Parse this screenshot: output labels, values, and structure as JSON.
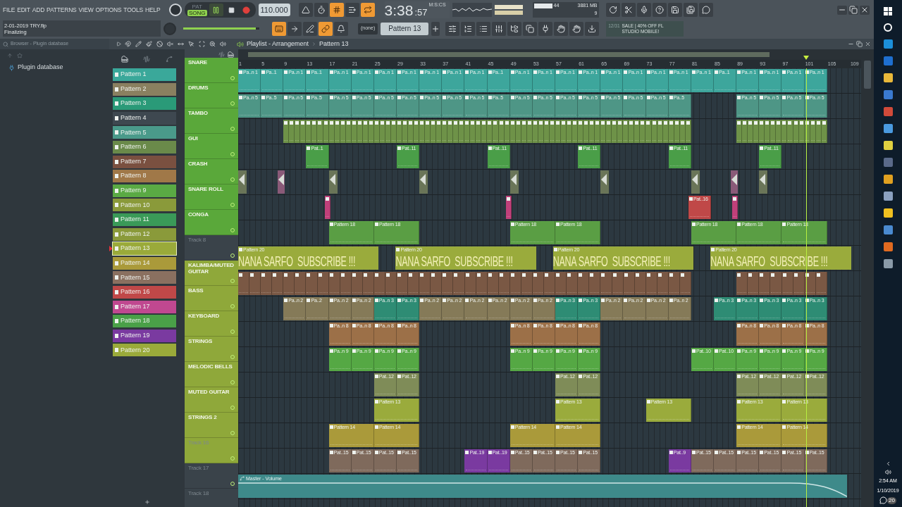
{
  "menu": [
    "FILE",
    "EDIT",
    "ADD",
    "PATTERNS",
    "VIEW",
    "OPTIONS",
    "TOOLS",
    "HELP"
  ],
  "project": {
    "file": "2-01-2019 TRY.flp",
    "status": "Finalizing"
  },
  "modes": [
    {
      "label": "PAT",
      "selected": false
    },
    {
      "label": "SONG",
      "selected": true
    }
  ],
  "tempo": "110.000",
  "time": {
    "main": "3:38",
    "cs": ":57",
    "unit": "M:S:CS"
  },
  "toggles_row1": [
    {
      "kind": "metronome",
      "on": false
    },
    {
      "kind": "wait",
      "on": false
    },
    {
      "kind": "countdown",
      "on": true
    },
    {
      "kind": "step",
      "on": false
    },
    {
      "kind": "loop",
      "on": true
    }
  ],
  "cpu": {
    "cpu": "44",
    "memory": "3881 MB",
    "polyphony": "9"
  },
  "main_volume": {
    "level": 0.95
  },
  "toggles_row2": [
    {
      "kind": "typing",
      "on": true
    },
    {
      "kind": "arrow",
      "on": false
    },
    {
      "kind": "pen",
      "on": false
    },
    {
      "kind": "link",
      "on": true
    },
    {
      "kind": "bell",
      "on": false
    }
  ],
  "pattern_picker": {
    "none": "(none)",
    "current": "Pattern 13"
  },
  "news": {
    "date": "12/31",
    "text": "SALE | 40% OFF FL STUDIO MOBILE!"
  },
  "browser": {
    "title": "Browser - Plugin database",
    "items": [
      {
        "label": "Plugin database"
      }
    ]
  },
  "playlist": {
    "title": "Playlist - Arrangement",
    "pattern": "Pattern 13",
    "patterns": [
      {
        "label": "Pattern 1",
        "color": "#3aa89a",
        "selected": false
      },
      {
        "label": "Pattern 2",
        "color": "#8a8060",
        "selected": false
      },
      {
        "label": "Pattern 3",
        "color": "#2a9a78",
        "selected": false
      },
      {
        "label": "Pattern 4",
        "color": "#3e4850",
        "selected": false
      },
      {
        "label": "Pattern 5",
        "color": "#4a9a8a",
        "selected": false
      },
      {
        "label": "Pattern 6",
        "color": "#6a8a4a",
        "selected": false
      },
      {
        "label": "Pattern 7",
        "color": "#7a5040",
        "selected": false
      },
      {
        "label": "Pattern 8",
        "color": "#a07848",
        "selected": false
      },
      {
        "label": "Pattern 9",
        "color": "#5aaa44",
        "selected": false
      },
      {
        "label": "Pattern 10",
        "color": "#8a9a3a",
        "selected": false
      },
      {
        "label": "Pattern 11",
        "color": "#3a9a58",
        "selected": false
      },
      {
        "label": "Pattern 12",
        "color": "#8a9a3a",
        "selected": false
      },
      {
        "label": "Pattern 13",
        "color": "#9aaa3a",
        "selected": true
      },
      {
        "label": "Pattern 14",
        "color": "#aa9a3a",
        "selected": false
      },
      {
        "label": "Pattern 15",
        "color": "#8a7060",
        "selected": false
      },
      {
        "label": "Pattern 16",
        "color": "#c04848",
        "selected": false
      },
      {
        "label": "Pattern 17",
        "color": "#c04890",
        "selected": false
      },
      {
        "label": "Pattern 18",
        "color": "#4aa048",
        "selected": false
      },
      {
        "label": "Pattern 19",
        "color": "#7a3aa0",
        "selected": false
      },
      {
        "label": "Pattern 20",
        "color": "#9aaa3a",
        "selected": false
      }
    ],
    "ruler": [
      "1",
      "5",
      "9",
      "13",
      "17",
      "21",
      "25",
      "29",
      "33",
      "37",
      "41",
      "45",
      "49",
      "53",
      "57",
      "61",
      "65",
      "69",
      "73",
      "77",
      "81",
      "85",
      "89",
      "93",
      "97",
      "101",
      "105",
      "109"
    ],
    "tracks": [
      {
        "name": "SNARE",
        "kind": "custom",
        "color": "#5aa83a",
        "blocks": [
          {
            "kind": "pattern",
            "color": "#3da69c",
            "labels": [
              "Pa..n 1",
              "Pa..1"
            ]
          },
          {
            "kind": "pattern",
            "color": "#3da69c",
            "labels": [
              "Pa..n 1",
              "Pa..1"
            ]
          },
          {
            "kind": "pattern",
            "color": "#3da69c",
            "labels": [
              "Pa..n 1",
              "Pa..n 1",
              "Pa..n 1",
              "Pa..n 1",
              "Pa..n 1",
              "Pa..n 1",
              "Pa..n 1",
              "Pa..1"
            ]
          },
          {
            "kind": "pattern",
            "color": "#3da69c",
            "labels": [
              "Pa..n 1",
              "Pa..n 1",
              "Pa..n 1",
              "Pa..n 1",
              "Pa..n 1",
              "Pa..n 1",
              "Pa..n 1",
              "Pa..n 1"
            ]
          },
          {
            "kind": "pattern",
            "color": "#3da69c",
            "labels": [
              "Pa..n 1",
              "Pa..1"
            ]
          },
          {
            "kind": "pattern",
            "color": "#3da69c",
            "labels": [
              "Pa..n 1",
              "Pa..n 1",
              "Pa..n 1",
              "Pa..n 1"
            ]
          }
        ]
      },
      {
        "name": "DRUMS",
        "kind": "custom",
        "color": "#5aa83a",
        "blocks": [
          {
            "kind": "pattern",
            "color": "#4e9686",
            "labels": [
              "Pa..n 5",
              "Pa..5"
            ]
          },
          {
            "kind": "pattern",
            "color": "#4e9686",
            "labels": [
              "Pa..n 5",
              "Pa..5"
            ]
          },
          {
            "kind": "pattern",
            "color": "#4e9686",
            "labels": [
              "Pa..n 5",
              "Pa..n 5",
              "Pa..n 5",
              "Pa..n 5",
              "Pa..n 5",
              "Pa..n 5",
              "Pa..n 5",
              "Pa..5"
            ]
          },
          {
            "kind": "pattern",
            "color": "#4e9686",
            "labels": [
              "Pa..n 5",
              "Pa..n 5",
              "Pa..n 5",
              "Pa..n 5",
              "Pa..n 5",
              "Pa..n 5",
              "Pa..n 5",
              "Pa..5"
            ]
          },
          {
            "kind": "pattern",
            "color": "#4e9686",
            "labels": [
              "Pa..n 5",
              "Pa..n 5",
              "Pa..n 5",
              "Pa..n 5"
            ]
          }
        ]
      },
      {
        "name": "TAMBO",
        "kind": "custom",
        "color": "#5aa83a",
        "blocks": [
          {
            "kind": "steps",
            "color": "#6e9248"
          },
          {
            "kind": "steps",
            "color": "#6e9248"
          },
          {
            "kind": "steps",
            "color": "#6e9248"
          },
          {
            "kind": "steps",
            "color": "#6e9248"
          }
        ]
      },
      {
        "name": "GUI",
        "kind": "custom",
        "color": "#5aa83a",
        "blocks": [
          {
            "kind": "pattern",
            "color": "#4a9e48",
            "labels": [
              "Pat..1"
            ]
          },
          {
            "kind": "pattern",
            "color": "#4a9e48",
            "labels": [
              "Pat..11"
            ]
          },
          {
            "kind": "pattern",
            "color": "#4a9e48",
            "labels": [
              "Pat..11"
            ]
          },
          {
            "kind": "pattern",
            "color": "#4a9e48",
            "labels": [
              "Pat..11"
            ]
          },
          {
            "kind": "pattern",
            "color": "#4a9e48",
            "labels": [
              "Pat..11"
            ]
          },
          {
            "kind": "pattern",
            "color": "#4a9e48",
            "labels": [
              "Pat..11"
            ]
          }
        ]
      },
      {
        "name": "CRASH",
        "kind": "custom",
        "color": "#5aa83a",
        "blocks": [
          {
            "kind": "audio",
            "color": "#6a7558"
          },
          {
            "kind": "audio",
            "color": "#8a5a78"
          },
          {
            "kind": "audio",
            "color": "#6a7558"
          },
          {
            "kind": "audio",
            "color": "#6a7558"
          },
          {
            "kind": "audio",
            "color": "#6a7558"
          },
          {
            "kind": "audio",
            "color": "#6a7558"
          },
          {
            "kind": "audio",
            "color": "#6a7558"
          },
          {
            "kind": "audio",
            "color": "#8a5a78"
          },
          {
            "kind": "audio",
            "color": "#6a7558"
          }
        ]
      },
      {
        "name": "SNARE ROLL",
        "kind": "custom",
        "color": "#5aa83a",
        "blocks": [
          {
            "kind": "steps",
            "color": "#c0407a"
          },
          {
            "kind": "steps",
            "color": "#c0407a"
          },
          {
            "kind": "pattern",
            "color": "#c04848",
            "labels": [
              "Pat..16"
            ]
          },
          {
            "kind": "steps",
            "color": "#c0407a"
          }
        ]
      },
      {
        "name": "CONGA",
        "kind": "custom",
        "color": "#5aa83a",
        "blocks": [
          {
            "kind": "pattern",
            "color": "#5a9e44",
            "labels": [
              "Pattern 18",
              "Pattern 18"
            ]
          },
          {
            "kind": "pattern",
            "color": "#5a9e44",
            "labels": [
              "Pattern 18",
              "Pattern 18"
            ]
          },
          {
            "kind": "pattern",
            "color": "#5a9e44",
            "labels": [
              "Pattern 18",
              "Pattern 18",
              "Pattern 18"
            ]
          }
        ]
      },
      {
        "name": "Track 8",
        "kind": "default",
        "color": "#3a434a",
        "blocks": [
          {
            "kind": "banner",
            "color": "#9aab3c",
            "labels": [
              "Pattern 20"
            ],
            "text": "NANA SARFO  SUBSCRIBE !!!"
          },
          {
            "kind": "banner",
            "color": "#9aab3c",
            "labels": [
              "Pattern 20"
            ],
            "text": "NANA SARFO  SUBSCRIBE !!!"
          },
          {
            "kind": "banner",
            "color": "#9aab3c",
            "labels": [
              "Pattern 20"
            ],
            "text": "NANA SARFO  SUBSCRIBE !!!"
          },
          {
            "kind": "banner",
            "color": "#9aab3c",
            "labels": [
              "Pattern 20"
            ],
            "text": "NANA SARFO  SUBSCRIBE !!!"
          }
        ]
      },
      {
        "name": "KALIMBA/MUTED GUITAR",
        "kind": "custom",
        "color": "#8fa83a",
        "blocks": [
          {
            "kind": "steps",
            "color": "#7a5844"
          },
          {
            "kind": "steps",
            "color": "#7a5844"
          },
          {
            "kind": "steps",
            "color": "#7a5844"
          }
        ]
      },
      {
        "name": "BASS",
        "kind": "custom",
        "color": "#8fa83a",
        "blocks": [
          {
            "kind": "pattern",
            "color": "#857a58",
            "labels": [
              "Pa..n 2",
              "Pa..2"
            ]
          },
          {
            "kind": "pattern",
            "color": "#857a58",
            "labels": [
              "Pa..n 2",
              "Pa..n 2"
            ]
          },
          {
            "kind": "pattern",
            "color": "#2e8c74",
            "labels": [
              "Pa..n 3",
              "Pa..n 3"
            ]
          },
          {
            "kind": "pattern",
            "color": "#857a58",
            "labels": [
              "Pa..n 2",
              "Pa..n 2",
              "Pa..n 2",
              "Pa..n 2",
              "Pa..n 2",
              "Pa..n 2"
            ]
          },
          {
            "kind": "pattern",
            "color": "#2e8c74",
            "labels": [
              "Pa..n 3",
              "Pa..n 3"
            ]
          },
          {
            "kind": "pattern",
            "color": "#857a58",
            "labels": [
              "Pa..n 2",
              "Pa..n 2",
              "Pa..n 2",
              "Pa..n 2"
            ]
          },
          {
            "kind": "pattern",
            "color": "#2e8c74",
            "labels": [
              "Pa..n 3",
              "Pa..n 3",
              "Pa..n 3",
              "Pa..n 3",
              "Pa..n 3"
            ]
          }
        ]
      },
      {
        "name": "KEYBOARD",
        "kind": "custom",
        "color": "#8fa83a",
        "blocks": [
          {
            "kind": "pattern",
            "color": "#9c7048",
            "labels": [
              "Pa..n 8",
              "Pa..n 8",
              "Pa..n 8",
              "Pa..n 8"
            ]
          },
          {
            "kind": "pattern",
            "color": "#9c7048",
            "labels": [
              "Pa..n 8",
              "Pa..n 8",
              "Pa..n 8",
              "Pa..n 8"
            ]
          },
          {
            "kind": "pattern",
            "color": "#9c7048",
            "labels": [
              "Pa..n 8",
              "Pa..n 8",
              "Pa..n 8",
              "Pa..n 8"
            ]
          }
        ]
      },
      {
        "name": "STRINGS",
        "kind": "custom",
        "color": "#8fa83a",
        "blocks": [
          {
            "kind": "pattern",
            "color": "#55a844",
            "labels": [
              "Pa..n 9",
              "Pa..n 9",
              "Pa..n 9",
              "Pa..n 9"
            ]
          },
          {
            "kind": "pattern",
            "color": "#55a844",
            "labels": [
              "Pa..n 9",
              "Pa..n 9",
              "Pa..n 9",
              "Pa..n 9"
            ]
          },
          {
            "kind": "pattern",
            "color": "#55a844",
            "labels": [
              "Pat..10",
              "Pat..10"
            ]
          },
          {
            "kind": "pattern",
            "color": "#55a844",
            "labels": [
              "Pa..n 9",
              "Pa..n 9",
              "Pa..n 9",
              "Pa..n 9"
            ]
          }
        ]
      },
      {
        "name": "MELODIC BELLS",
        "kind": "custom",
        "color": "#8fa83a",
        "blocks": [
          {
            "kind": "pattern",
            "color": "#7f8c58",
            "labels": [
              "Pat..12",
              "Pat..12"
            ]
          },
          {
            "kind": "pattern",
            "color": "#7f8c58",
            "labels": [
              "Pat..12",
              "Pat..12"
            ]
          },
          {
            "kind": "pattern",
            "color": "#7f8c58",
            "labels": [
              "Pat..12",
              "Pat..12",
              "Pat..12",
              "Pat..12"
            ]
          }
        ]
      },
      {
        "name": "MUTED GUITAR",
        "kind": "custom",
        "color": "#8fa83a",
        "blocks": [
          {
            "kind": "pattern",
            "color": "#9aab3c",
            "labels": [
              "Pattern 13"
            ]
          },
          {
            "kind": "pattern",
            "color": "#9aab3c",
            "labels": [
              "Pattern 13"
            ]
          },
          {
            "kind": "pattern",
            "color": "#9aab3c",
            "labels": [
              "Pattern 13"
            ]
          },
          {
            "kind": "pattern",
            "color": "#9aab3c",
            "labels": [
              "Pattern 13",
              "Pattern 13"
            ]
          }
        ]
      },
      {
        "name": "STRINGS 2",
        "kind": "custom",
        "color": "#8fa83a",
        "blocks": [
          {
            "kind": "pattern",
            "color": "#aa9a3a",
            "labels": [
              "Pattern 14",
              "Pattern 14"
            ]
          },
          {
            "kind": "pattern",
            "color": "#aa9a3a",
            "labels": [
              "Pattern 14",
              "Pattern 14"
            ]
          },
          {
            "kind": "pattern",
            "color": "#aa9a3a",
            "labels": [
              "Pattern 14",
              "Pattern 14"
            ]
          }
        ]
      },
      {
        "name": "Track 16",
        "kind": "default",
        "color": "#8fa83a",
        "blocks": [
          {
            "kind": "pattern",
            "color": "#7f6a5c",
            "labels": [
              "Pat..15",
              "Pat..15",
              "Pat..15",
              "Pat..15"
            ]
          },
          {
            "kind": "pattern",
            "color": "#7a3aa0",
            "labels": [
              "Pat..19",
              "Pat..19"
            ]
          },
          {
            "kind": "pattern",
            "color": "#7f6a5c",
            "labels": [
              "Pat..15",
              "Pat..15",
              "Pat..15",
              "Pat..15"
            ]
          },
          {
            "kind": "pattern",
            "color": "#7a3aa0",
            "labels": [
              "Pat..9"
            ]
          },
          {
            "kind": "pattern",
            "color": "#7f6a5c",
            "labels": [
              "Pat..15",
              "Pat..15",
              "Pat..15",
              "Pat..15",
              "Pat..15",
              "Pat..15"
            ]
          }
        ]
      },
      {
        "name": "Track 17",
        "kind": "default",
        "color": "#3a434a",
        "blocks": [
          {
            "kind": "automation",
            "color": "#3e8a8a",
            "labels": [
              "Master - Volume"
            ]
          }
        ]
      },
      {
        "name": "Track 18",
        "kind": "default",
        "color": "#3a434a"
      }
    ]
  },
  "taskbar": {
    "time": "2:54 AM",
    "date": "1/10/2019",
    "notifications": "20"
  }
}
